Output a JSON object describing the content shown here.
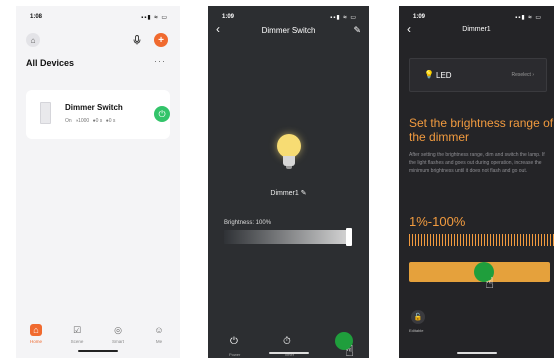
{
  "phone1": {
    "time": "1:08",
    "signal": "▪▪▮ ≈ ▭",
    "icons": {
      "home": "⌂",
      "mic": "🎙",
      "add": "+"
    },
    "section_title": "All Devices",
    "more": "···",
    "device": {
      "name": "Dimmer Switch",
      "status": [
        "On",
        "◑1000",
        "●0 s",
        "●0 s"
      ],
      "power_icon": "⏻"
    },
    "tabs": [
      {
        "label": "Home",
        "icon": "⌂"
      },
      {
        "label": "Scene",
        "icon": "☑"
      },
      {
        "label": "Smart",
        "icon": "◎"
      },
      {
        "label": "Me",
        "icon": "☺"
      }
    ],
    "accent_color": "#f06a2f"
  },
  "phone2": {
    "time": "1:09",
    "signal": "▪▪▮ ≈ ▭",
    "title": "Dimmer Switch",
    "back_icon": "‹",
    "edit_icon": "✎",
    "device_name": "Dimmer1",
    "brightness_label": "Brightness: 100%",
    "brightness_level": 1.0,
    "bottom_items": [
      {
        "label": "Power",
        "icon": "⏻"
      },
      {
        "label": "Timer",
        "icon": "⏱"
      },
      {
        "label": "",
        "icon": ""
      }
    ]
  },
  "phone3": {
    "time": "1:09",
    "signal": "▪▪▮ ≈ ▭",
    "title": "Dimmer1",
    "back_icon": "‹",
    "led": {
      "icon": "💡",
      "label": "LED",
      "action": "Reselect  ›"
    },
    "heading": "Set the brightness range of the dimmer",
    "description": "After setting the brightness range, dim and switch the lamp. If the light flashes and goes out during operation, increase the minimum brightness until it does not flash and go out.",
    "range": "1%-100%",
    "editable_label": "Editable",
    "editable_icon": "🔓",
    "accent_color": "#f29b3f"
  }
}
